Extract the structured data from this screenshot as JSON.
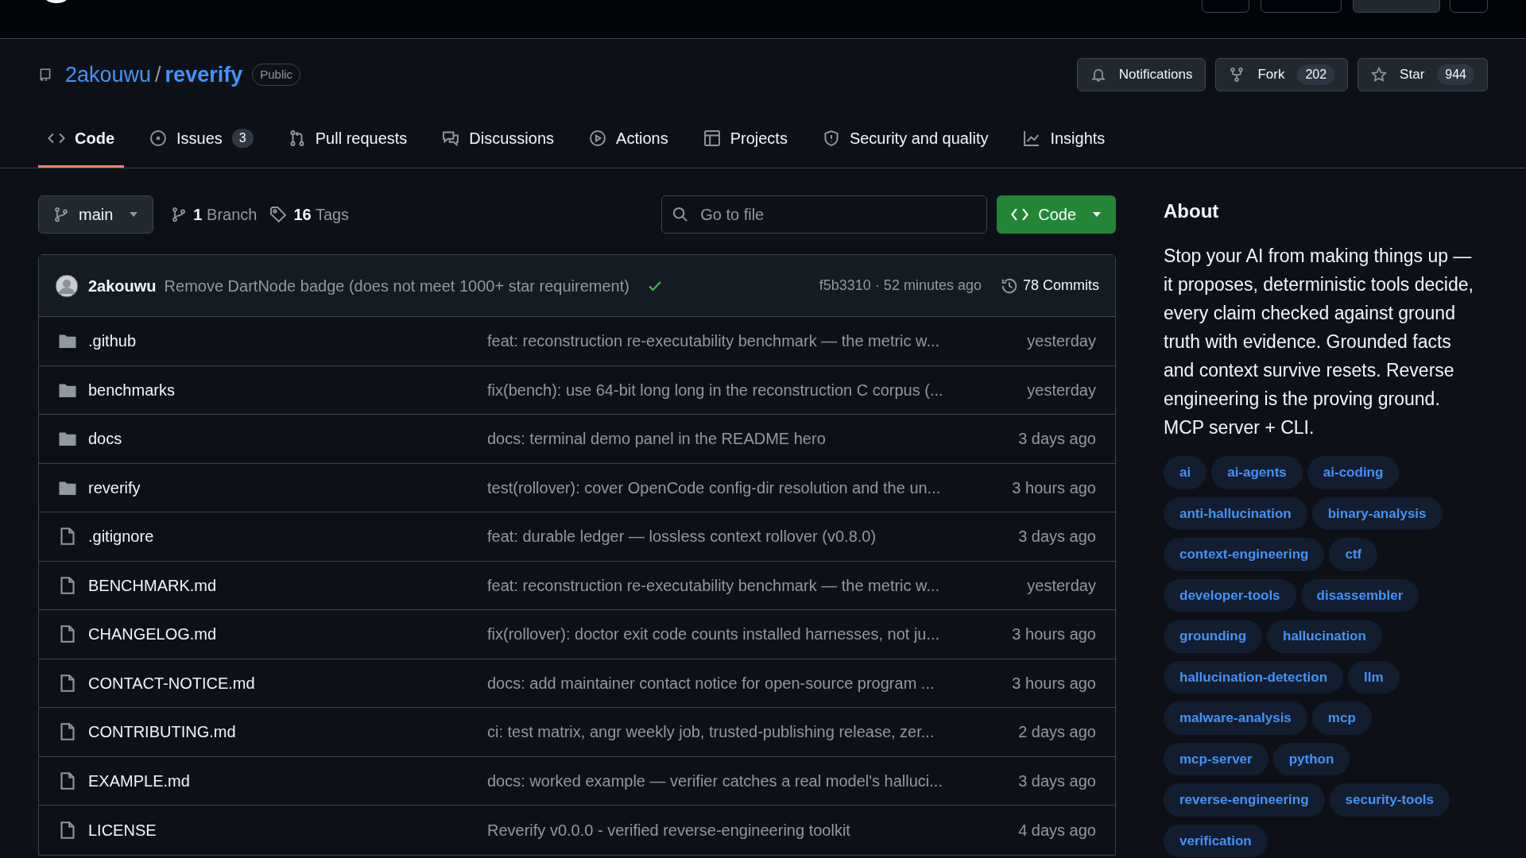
{
  "repo": {
    "owner": "2akouwu",
    "separator": "/",
    "name": "reverify",
    "visibility": "Public"
  },
  "actions": [
    {
      "kind": "notifications",
      "label": "Notifications"
    },
    {
      "kind": "fork",
      "label": "Fork",
      "count": "202"
    },
    {
      "kind": "star",
      "label": "Star",
      "count": "944"
    }
  ],
  "tabs": [
    {
      "label": "Code",
      "selected": true
    },
    {
      "label": "Issues",
      "count": "3",
      "selected": false
    },
    {
      "label": "Pull requests",
      "selected": false
    },
    {
      "label": "Discussions",
      "selected": false
    },
    {
      "label": "Actions",
      "selected": false
    },
    {
      "label": "Projects",
      "selected": false
    },
    {
      "label": "Security and quality",
      "selected": false
    },
    {
      "label": "Insights",
      "selected": false
    }
  ],
  "branch": {
    "name": "main",
    "branches_count": "1",
    "branches_label": "Branch",
    "tags_count": "16",
    "tags_label": "Tags"
  },
  "search": {
    "placeholder": "Go to file"
  },
  "code_button": "Code",
  "latest_commit": {
    "author": "2akouwu",
    "message": "Remove DartNode badge (does not meet 1000+ star requirement)",
    "checks_passed": true,
    "hash_time": "f5b3310 · 52 minutes ago",
    "commits": "78 Commits"
  },
  "files": [
    {
      "kind": "folder",
      "name": ".github",
      "message": "feat: reconstruction re-executability benchmark — the metric w...",
      "time": "yesterday"
    },
    {
      "kind": "folder",
      "name": "benchmarks",
      "message": "fix(bench): use 64-bit long long in the reconstruction C corpus (...",
      "time": "yesterday"
    },
    {
      "kind": "folder",
      "name": "docs",
      "message": "docs: terminal demo panel in the README hero",
      "time": "3 days ago"
    },
    {
      "kind": "folder",
      "name": "reverify",
      "message": "test(rollover): cover OpenCode config-dir resolution and the un...",
      "time": "3 hours ago"
    },
    {
      "kind": "file",
      "name": ".gitignore",
      "message": "feat: durable ledger — lossless context rollover (v0.8.0)",
      "time": "3 days ago"
    },
    {
      "kind": "file",
      "name": "BENCHMARK.md",
      "message": "feat: reconstruction re-executability benchmark — the metric w...",
      "time": "yesterday"
    },
    {
      "kind": "file",
      "name": "CHANGELOG.md",
      "message": "fix(rollover): doctor exit code counts installed harnesses, not ju...",
      "time": "3 hours ago"
    },
    {
      "kind": "file",
      "name": "CONTACT-NOTICE.md",
      "message": "docs: add maintainer contact notice for open-source program ...",
      "time": "3 hours ago"
    },
    {
      "kind": "file",
      "name": "CONTRIBUTING.md",
      "message": "ci: test matrix, angr weekly job, trusted-publishing release, zer...",
      "time": "2 days ago"
    },
    {
      "kind": "file",
      "name": "EXAMPLE.md",
      "message": "docs: worked example — verifier catches a real model's halluci...",
      "time": "3 days ago"
    },
    {
      "kind": "file",
      "name": "LICENSE",
      "message": "Reverify v0.0.0 - verified reverse-engineering toolkit",
      "time": "4 days ago"
    }
  ],
  "about": {
    "title": "About",
    "description": "Stop your AI from making things up — it proposes, deterministic tools decide, every claim checked against ground truth with evidence. Grounded facts and context survive resets. Reverse engineering is the proving ground. MCP server + CLI.",
    "topics": [
      "ai",
      "ai-agents",
      "ai-coding",
      "anti-hallucination",
      "binary-analysis",
      "context-engineering",
      "ctf",
      "developer-tools",
      "disassembler",
      "grounding",
      "hallucination",
      "hallucination-detection",
      "llm",
      "malware-analysis",
      "mcp",
      "mcp-server",
      "python",
      "reverse-engineering",
      "security-tools",
      "verification"
    ]
  }
}
